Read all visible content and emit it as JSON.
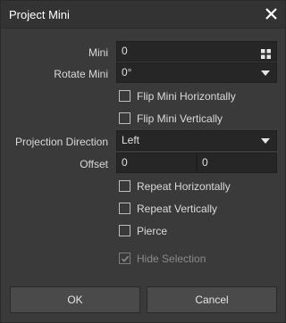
{
  "dialog": {
    "title": "Project Mini"
  },
  "fields": {
    "mini_label": "Mini",
    "mini_value": "0",
    "rotate_label": "Rotate Mini",
    "rotate_value": "0°",
    "projection_label": "Projection Direction",
    "projection_value": "Left",
    "offset_label": "Offset",
    "offset_x": "0",
    "offset_y": "0"
  },
  "checkboxes": {
    "flip_h": "Flip Mini Horizontally",
    "flip_v": "Flip Mini Vertically",
    "repeat_h": "Repeat Horizontally",
    "repeat_v": "Repeat Vertically",
    "pierce": "Pierce",
    "hide_selection": "Hide Selection"
  },
  "buttons": {
    "ok": "OK",
    "cancel": "Cancel"
  }
}
